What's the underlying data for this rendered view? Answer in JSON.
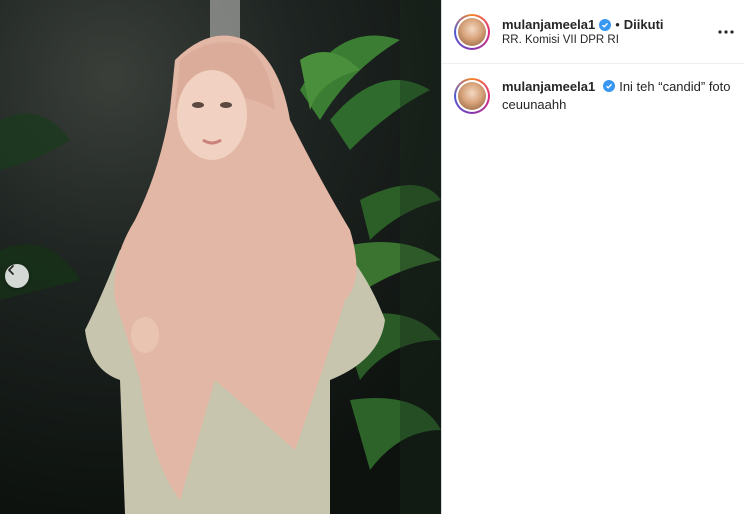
{
  "media": {
    "prev_icon": "chevron-left-icon"
  },
  "header": {
    "username": "mulanjameela1",
    "verified_icon": "verified-badge-icon",
    "separator": "•",
    "follow_status": "Diikuti",
    "location": "RR. Komisi VII DPR RI",
    "more_icon": "more-horizontal-icon"
  },
  "caption": {
    "username": "mulanjameela1",
    "text": "Ini teh “candid” foto ceuunaahh"
  },
  "colors": {
    "verified": "#3897f0",
    "text": "#262626",
    "border": "#dbdbdb"
  }
}
